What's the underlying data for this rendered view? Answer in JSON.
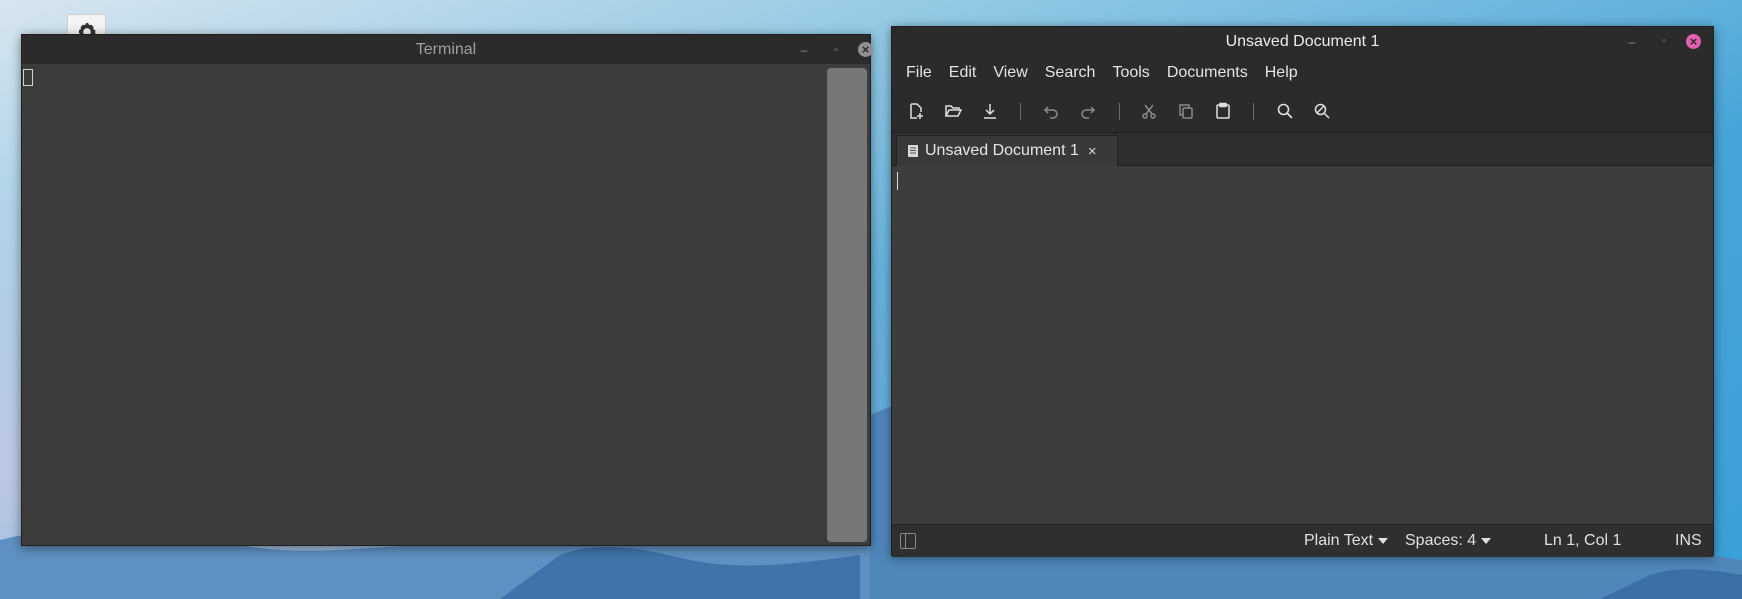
{
  "desktop": {
    "icon": "gear-icon"
  },
  "terminal": {
    "title": "Terminal",
    "controls": {
      "minimize": "–",
      "maximize": "▫",
      "close": "×"
    }
  },
  "editor": {
    "title": "Unsaved Document 1",
    "controls": {
      "minimize": "–",
      "maximize": "▫",
      "close": "×"
    },
    "menu": [
      "File",
      "Edit",
      "View",
      "Search",
      "Tools",
      "Documents",
      "Help"
    ],
    "toolbar": [
      "new-document-icon",
      "open-icon",
      "save-icon",
      "undo-icon",
      "redo-icon",
      "cut-icon",
      "copy-icon",
      "paste-icon",
      "find-icon",
      "find-replace-icon"
    ],
    "tab": {
      "label": "Unsaved Document 1",
      "close": "×"
    },
    "statusbar": {
      "language": "Plain Text",
      "spaces": "Spaces: 4",
      "position": "Ln 1, Col 1",
      "mode": "INS"
    }
  },
  "colors": {
    "window_bg": "#3c3c3c",
    "titlebar_bg": "#2b2b2b",
    "close_accent": "#e25fb1"
  }
}
